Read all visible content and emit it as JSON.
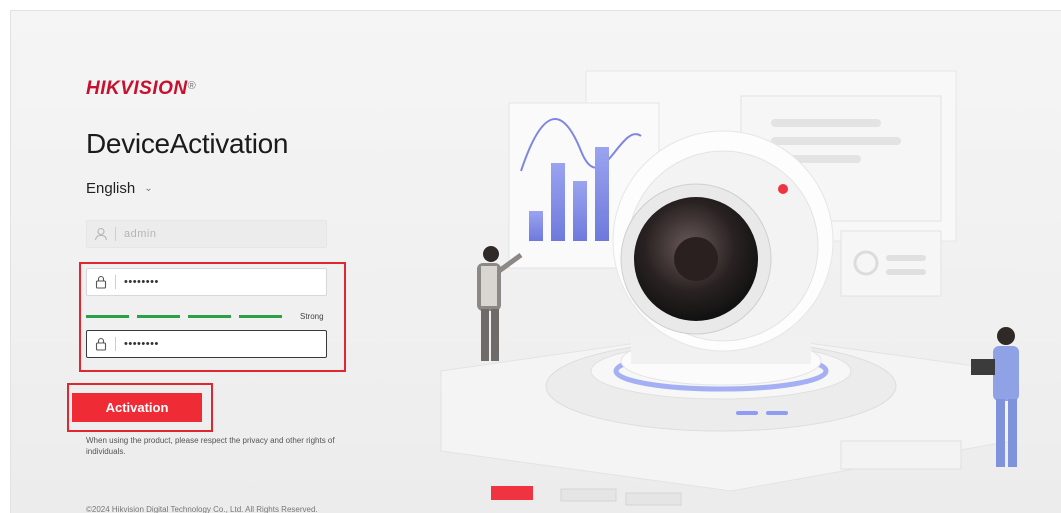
{
  "brand": {
    "name_part1": "HIK",
    "name_part2": "VISION",
    "registered": "®"
  },
  "page_title": "DeviceActivation",
  "language": {
    "selected": "English"
  },
  "username": {
    "value": "admin"
  },
  "password": {
    "value": "••••••••"
  },
  "confirm_password": {
    "value": "••••••••"
  },
  "strength": {
    "label": "Strong",
    "level": 4,
    "max": 4
  },
  "activation_button": "Activation",
  "privacy_notice": "When using the product, please respect the privacy and other rights of individuals.",
  "copyright": "©2024 Hikvision Digital Technology Co., Ltd. All Rights Reserved.",
  "colors": {
    "brand": "#c8102e",
    "button": "#ef2b36",
    "strength": "#2aa147",
    "highlight": "#e0262e"
  },
  "icons": [
    "user-icon",
    "lock-icon",
    "chevron-down-icon"
  ]
}
